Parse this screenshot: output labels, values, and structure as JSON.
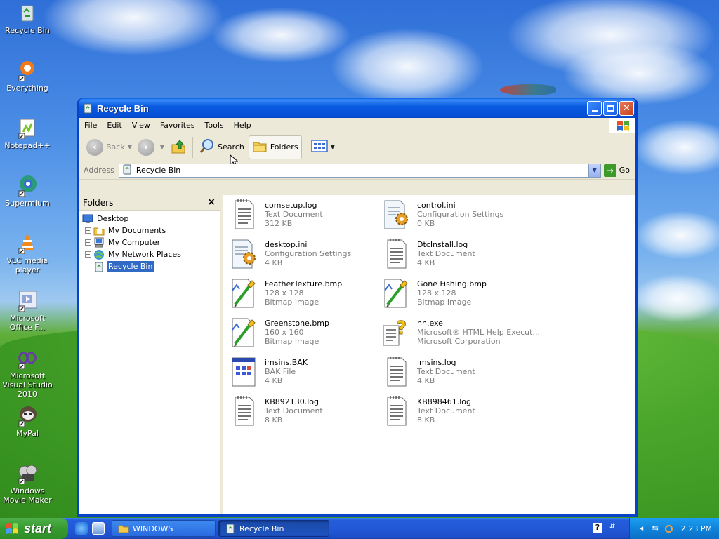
{
  "desktop": {
    "icons": [
      {
        "label": "Recycle Bin",
        "icon": "recycle-bin-icon"
      },
      {
        "label": "Everything",
        "icon": "everything-icon"
      },
      {
        "label": "Notepad++",
        "icon": "notepadpp-icon"
      },
      {
        "label": "Supermium",
        "icon": "supermium-icon"
      },
      {
        "label": "VLC media player",
        "icon": "vlc-icon"
      },
      {
        "label": "Microsoft Office F...",
        "icon": "office-icon"
      },
      {
        "label": "Microsoft Visual Studio 2010",
        "icon": "visual-studio-icon"
      },
      {
        "label": "MyPal",
        "icon": "mypal-icon"
      },
      {
        "label": "Windows Movie Maker",
        "icon": "movie-maker-icon"
      }
    ]
  },
  "window": {
    "title": "Recycle Bin",
    "menu": [
      "File",
      "Edit",
      "View",
      "Favorites",
      "Tools",
      "Help"
    ],
    "toolbar": {
      "back": "Back",
      "search": "Search",
      "folders": "Folders"
    },
    "address": {
      "label": "Address",
      "value": "Recycle Bin",
      "go": "Go"
    },
    "folders_pane": {
      "title": "Folders",
      "tree": [
        {
          "label": "Desktop",
          "level": 0,
          "expandable": false,
          "selected": false
        },
        {
          "label": "My Documents",
          "level": 1,
          "expandable": true,
          "selected": false
        },
        {
          "label": "My Computer",
          "level": 1,
          "expandable": true,
          "selected": false
        },
        {
          "label": "My Network Places",
          "level": 1,
          "expandable": true,
          "selected": false
        },
        {
          "label": "Recycle Bin",
          "level": 1,
          "expandable": false,
          "selected": true
        }
      ]
    },
    "files": [
      {
        "name": "comsetup.log",
        "type": "Text Document",
        "detail": "312 KB",
        "icon": "text-document-icon"
      },
      {
        "name": "control.ini",
        "type": "Configuration Settings",
        "detail": "0 KB",
        "icon": "config-settings-icon"
      },
      {
        "name": "desktop.ini",
        "type": "Configuration Settings",
        "detail": "4 KB",
        "icon": "config-settings-icon"
      },
      {
        "name": "DtcInstall.log",
        "type": "Text Document",
        "detail": "4 KB",
        "icon": "text-document-icon"
      },
      {
        "name": "FeatherTexture.bmp",
        "type": "128 x 128",
        "detail": "Bitmap Image",
        "icon": "bitmap-image-icon"
      },
      {
        "name": "Gone Fishing.bmp",
        "type": "128 x 128",
        "detail": "Bitmap Image",
        "icon": "bitmap-image-icon"
      },
      {
        "name": "Greenstone.bmp",
        "type": "160 x 160",
        "detail": "Bitmap Image",
        "icon": "bitmap-image-icon"
      },
      {
        "name": "hh.exe",
        "type": "Microsoft® HTML Help Execut...",
        "detail": "Microsoft Corporation",
        "icon": "help-exe-icon"
      },
      {
        "name": "imsins.BAK",
        "type": "BAK File",
        "detail": "4 KB",
        "icon": "bak-file-icon"
      },
      {
        "name": "imsins.log",
        "type": "Text Document",
        "detail": "4 KB",
        "icon": "text-document-icon"
      },
      {
        "name": "KB892130.log",
        "type": "Text Document",
        "detail": "8 KB",
        "icon": "text-document-icon"
      },
      {
        "name": "KB898461.log",
        "type": "Text Document",
        "detail": "8 KB",
        "icon": "text-document-icon"
      }
    ]
  },
  "taskbar": {
    "start": "start",
    "tasks": [
      {
        "label": "WINDOWS",
        "icon": "folder-icon",
        "active": false
      },
      {
        "label": "Recycle Bin",
        "icon": "recycle-bin-icon",
        "active": true
      }
    ],
    "clock": "2:23 PM"
  }
}
